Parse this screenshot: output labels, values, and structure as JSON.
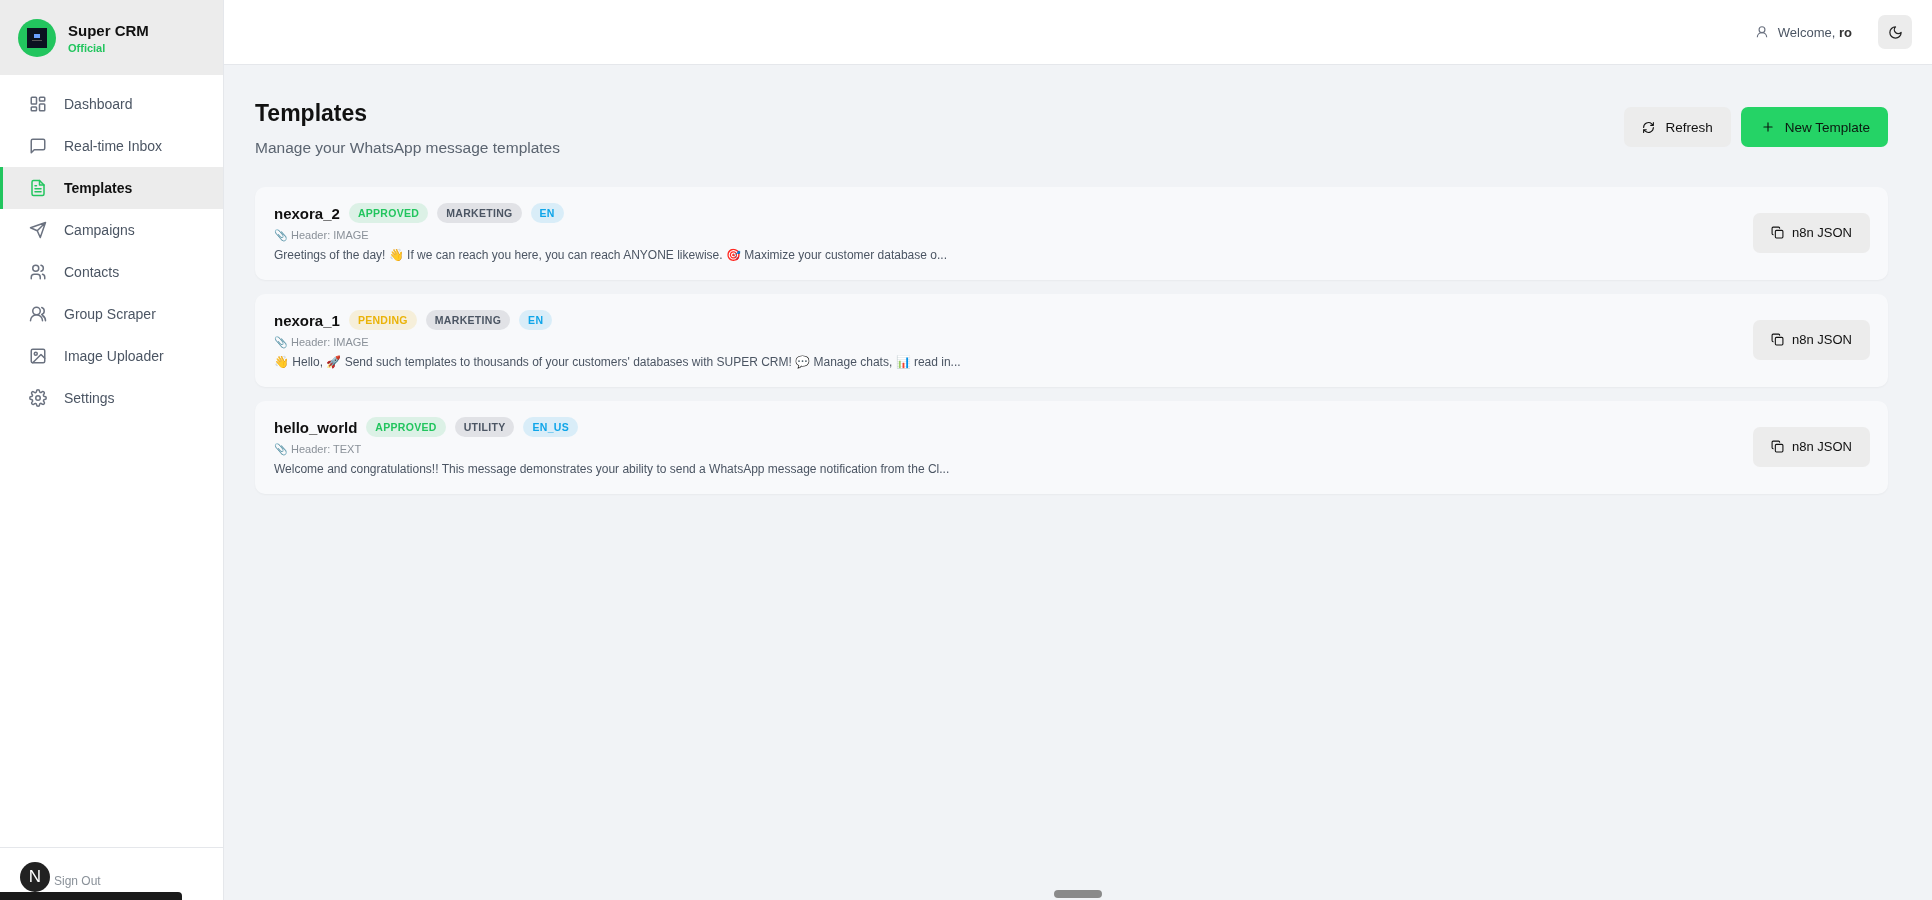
{
  "brand": {
    "name": "Super CRM",
    "tag": "Official"
  },
  "sidebar": {
    "items": [
      {
        "label": "Dashboard",
        "selected": false
      },
      {
        "label": "Real-time Inbox",
        "selected": false
      },
      {
        "label": "Templates",
        "selected": true
      },
      {
        "label": "Campaigns",
        "selected": false
      },
      {
        "label": "Contacts",
        "selected": false
      },
      {
        "label": "Group Scraper",
        "selected": false
      },
      {
        "label": "Image Uploader",
        "selected": false
      },
      {
        "label": "Settings",
        "selected": false
      }
    ],
    "sign_out": "Sign Out",
    "dev_badge": "N"
  },
  "header": {
    "welcome": "Welcome, ",
    "user": "ro"
  },
  "page": {
    "title": "Templates",
    "subtitle": "Manage your WhatsApp message templates",
    "buttons": [
      {
        "label": "Refresh",
        "kind": "secondary"
      },
      {
        "label": "New Template",
        "kind": "primary"
      }
    ]
  },
  "templates": [
    {
      "name": "nexora_2",
      "badges": [
        {
          "label": "APPROVED",
          "color": "#22c55e"
        },
        {
          "label": "MARKETING",
          "color": "#4b5563"
        },
        {
          "label": "EN",
          "color": "#0ea5e9"
        }
      ],
      "header_icon": "📎",
      "header": "Header: IMAGE",
      "body": "Greetings of the day! 👋 If we can reach you here, you can reach ANYONE likewise. 🎯 Maximize your customer database o...",
      "action": "n8n JSON"
    },
    {
      "name": "nexora_1",
      "badges": [
        {
          "label": "PENDING",
          "color": "#eab308"
        },
        {
          "label": "MARKETING",
          "color": "#4b5563"
        },
        {
          "label": "EN",
          "color": "#0ea5e9"
        }
      ],
      "header_icon": "📎",
      "header": "Header: IMAGE",
      "body": "👋 Hello, 🚀 Send such templates to thousands of your customers' databases with SUPER CRM! 💬 Manage chats, 📊 read in...",
      "action": "n8n JSON"
    },
    {
      "name": "hello_world",
      "badges": [
        {
          "label": "APPROVED",
          "color": "#22c55e"
        },
        {
          "label": "UTILITY",
          "color": "#4b5563"
        },
        {
          "label": "EN_US",
          "color": "#0ea5e9"
        }
      ],
      "header_icon": "📎",
      "header": "Header: TEXT",
      "body": "Welcome and congratulations!! This message demonstrates your ability to send a WhatsApp message notification from the Cl...",
      "action": "n8n JSON"
    }
  ]
}
